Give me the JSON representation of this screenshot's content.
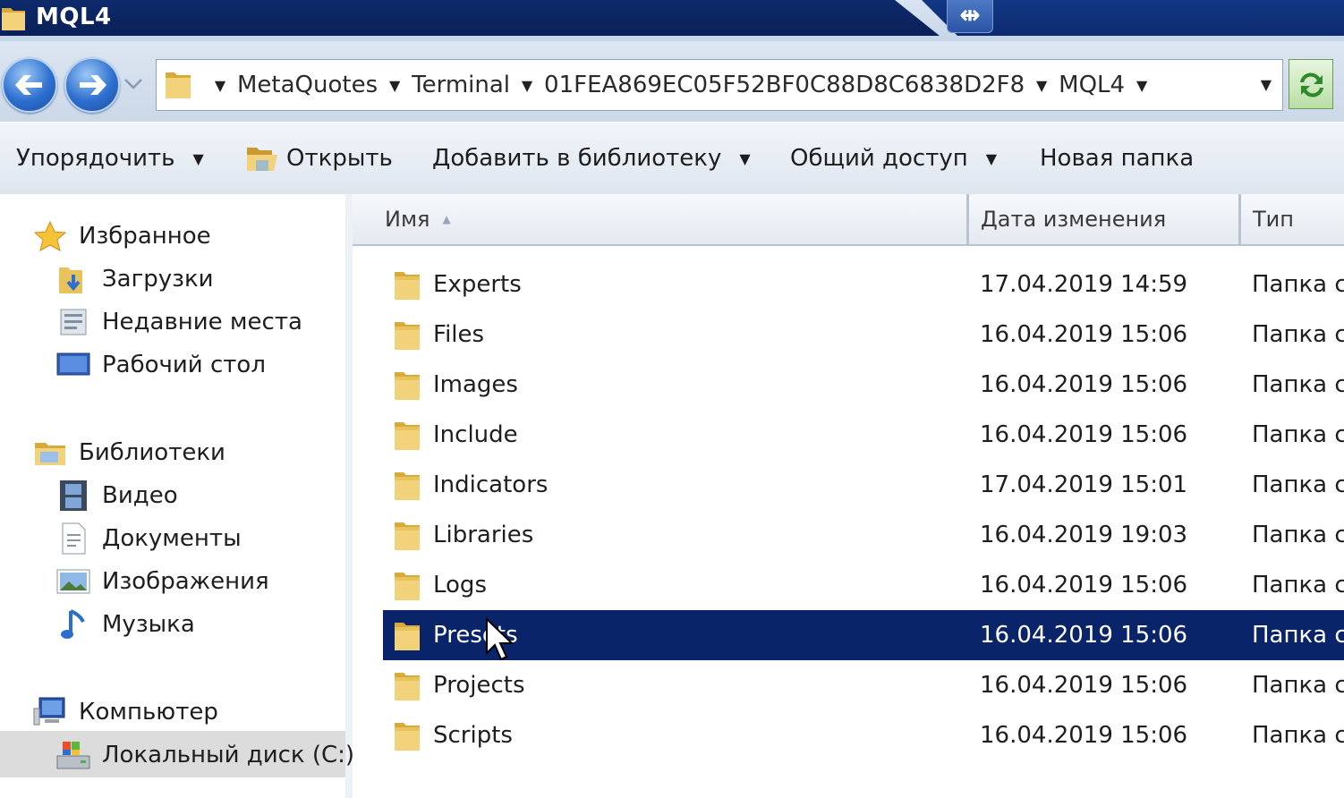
{
  "window": {
    "title": "MQL4"
  },
  "address_bar": {
    "breadcrumb": [
      "MetaQuotes",
      "Terminal",
      "01FEA869EC05F52BF0C88D8C6838D2F8",
      "MQL4"
    ]
  },
  "toolbar": {
    "organize_label": "Упорядочить",
    "open_label": "Открыть",
    "add_to_library_label": "Добавить в библиотеку",
    "share_label": "Общий доступ",
    "new_folder_label": "Новая папка"
  },
  "nav": {
    "favorites": {
      "label": "Избранное",
      "items": [
        "Загрузки",
        "Недавние места",
        "Рабочий стол"
      ]
    },
    "libraries": {
      "label": "Библиотеки",
      "items": [
        "Видео",
        "Документы",
        "Изображения",
        "Музыка"
      ]
    },
    "computer": {
      "label": "Компьютер",
      "items": [
        "Локальный диск (C:)"
      ]
    }
  },
  "columns": {
    "name": "Имя",
    "date": "Дата изменения",
    "type": "Тип"
  },
  "files": [
    {
      "name": "Experts",
      "date": "17.04.2019 14:59",
      "type": "Папка с"
    },
    {
      "name": "Files",
      "date": "16.04.2019 15:06",
      "type": "Папка с"
    },
    {
      "name": "Images",
      "date": "16.04.2019 15:06",
      "type": "Папка с"
    },
    {
      "name": "Include",
      "date": "16.04.2019 15:06",
      "type": "Папка с"
    },
    {
      "name": "Indicators",
      "date": "17.04.2019 15:01",
      "type": "Папка с"
    },
    {
      "name": "Libraries",
      "date": "16.04.2019 19:03",
      "type": "Папка с"
    },
    {
      "name": "Logs",
      "date": "16.04.2019 15:06",
      "type": "Папка с"
    },
    {
      "name": "Presets",
      "date": "16.04.2019 15:06",
      "type": "Папка с",
      "selected": true
    },
    {
      "name": "Projects",
      "date": "16.04.2019 15:06",
      "type": "Папка с"
    },
    {
      "name": "Scripts",
      "date": "16.04.2019 15:06",
      "type": "Папка с"
    }
  ],
  "colors": {
    "selection": "#0a246a",
    "title_bar": "#0e2a6c",
    "folder": "#e8c25a"
  },
  "icons": {
    "title": "folder-icon",
    "back": "back-arrow-icon",
    "forward": "forward-arrow-icon",
    "refresh": "refresh-icon",
    "open": "open-folder-icon",
    "favorites": "star-icon",
    "downloads": "downloads-icon",
    "recent": "recent-places-icon",
    "desktop": "desktop-icon",
    "libraries": "libraries-icon",
    "video": "video-icon",
    "documents": "document-icon",
    "images": "image-icon",
    "music": "music-note-icon",
    "computer": "computer-icon",
    "drive": "local-disk-icon",
    "pin": "pin-icon",
    "cursor": "mouse-cursor-icon"
  }
}
